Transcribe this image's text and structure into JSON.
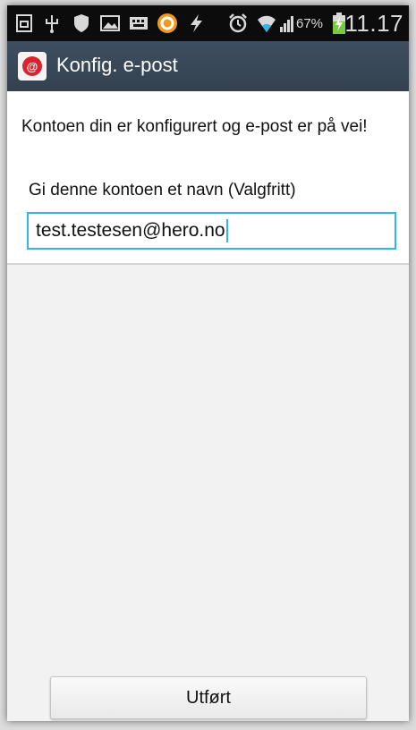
{
  "status_bar": {
    "icons": [
      "screenshot-icon",
      "usb-icon",
      "shield-icon",
      "gallery-icon",
      "keyboard-icon",
      "app-notification-icon",
      "flash-icon",
      "alarm-icon",
      "wifi-icon",
      "signal-icon",
      "battery-charging-icon"
    ],
    "battery_percent": "67%",
    "time": "11.17"
  },
  "action_bar": {
    "app_icon": "email-icon",
    "app_icon_glyph": "@",
    "title": "Konfig. e-post"
  },
  "content": {
    "message": "Kontoen din er konfigurert og e-post er på vei!",
    "account_name_label": "Gi denne kontoen et navn (Valgfritt)",
    "account_name_value": "test.testesen@hero.no",
    "accent_color": "#33b5e5"
  },
  "footer": {
    "done_label": "Utført"
  }
}
